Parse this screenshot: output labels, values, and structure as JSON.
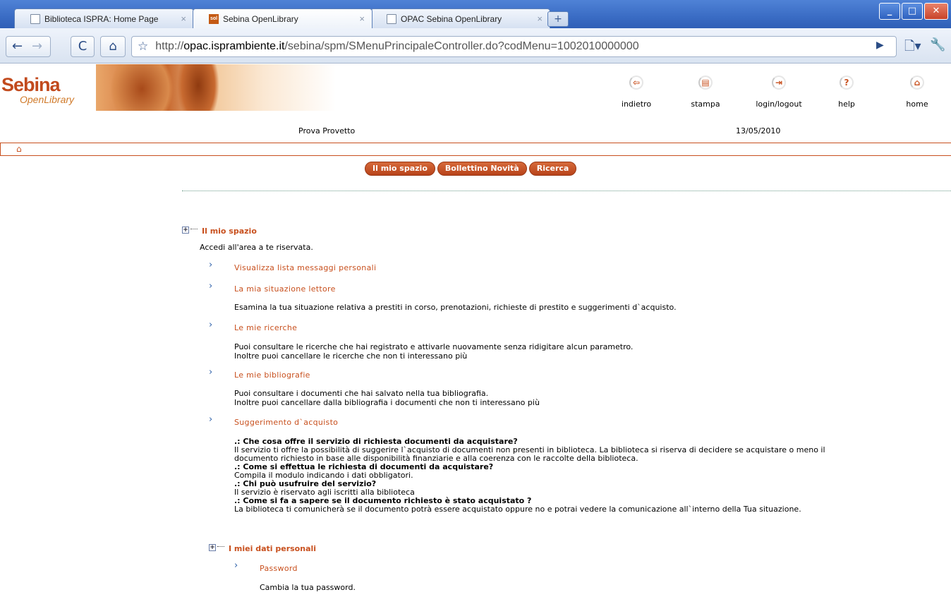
{
  "browser": {
    "tabs": [
      {
        "title": "Biblioteca ISPRA: Home Page",
        "favicon": "document-icon"
      },
      {
        "title": "Sebina OpenLibrary",
        "favicon": "sol-icon",
        "active": true
      },
      {
        "title": "OPAC Sebina OpenLibrary",
        "favicon": "document-icon"
      }
    ],
    "tab_close": "×",
    "new_tab": "+",
    "url_prefix": "http://",
    "url_host": "opac.isprambiente.it",
    "url_path": "/sebina/spm/SMenuPrincipaleController.do?codMenu=1002010000000"
  },
  "header": {
    "logo_main": "Sebina",
    "logo_sub": "OpenLibrary",
    "icons": [
      {
        "label": "indietro",
        "icon": "back-icon"
      },
      {
        "label": "stampa",
        "icon": "print-icon"
      },
      {
        "label": "login/logout",
        "icon": "login-icon"
      },
      {
        "label": "help",
        "icon": "help-icon"
      },
      {
        "label": "home",
        "icon": "home-icon"
      }
    ],
    "user": "Prova Provetto",
    "date": "13/05/2010"
  },
  "menu": [
    "Il mio spazio",
    "Bollettino Novità",
    "Ricerca"
  ],
  "content": {
    "section1_title": "Il mio spazio",
    "section1_desc": "Accedi all'area a te riservata.",
    "links": {
      "messaggi": "Visualizza lista messaggi personali",
      "situazione": "La mia situazione lettore",
      "ricerche": "Le mie ricerche",
      "bibliografie": "Le mie bibliografie",
      "suggerimento": "Suggerimento d`acquisto",
      "password": "Password"
    },
    "situazione_desc": "Esamina la tua situazione relativa a prestiti in corso, prenotazioni, richieste di prestito e suggerimenti d`acquisto.",
    "ricerche_desc1": "Puoi consultare le ricerche che hai registrato e attivarle nuovamente senza ridigitare alcun parametro.",
    "ricerche_desc2": "Inoltre puoi cancellare le ricerche che non ti interessano più",
    "bibliografie_desc1": "Puoi consultare i documenti che hai salvato nella tua bibliografia.",
    "bibliografie_desc2": "Inoltre puoi cancellare dalla bibliografia i documenti che non ti interessano più",
    "faq": {
      "q1": ".: Che cosa offre il servizio di richiesta documenti da acquistare?",
      "a1_line1": "Il servizio ti offre la possibilità di suggerire l`acquisto di documenti non presenti in biblioteca. La biblioteca si riserva di decidere se acquistare o meno il",
      "a1_line2": "documento richiesto in base alle disponibilità finanziarie e alla coerenza con le raccolte della biblioteca.",
      "q2": ".: Come si effettua le richiesta di documenti da acquistare?",
      "a2": "Compila il modulo indicando i dati obbligatori.",
      "q3": ".: Chi può usufruire del servizio?",
      "a3": "Il servizio è riservato agli iscritti alla biblioteca",
      "q4": ".: Come si fa a sapere se il documento richiesto è stato acquistato ?",
      "a4": "La biblioteca ti comunicherà se il documento potrà essere acquistato oppure no e potrai vedere la comunicazione all`interno della Tua situazione."
    },
    "section2_title": "I miei dati personali",
    "password_desc": "Cambia la tua password."
  }
}
